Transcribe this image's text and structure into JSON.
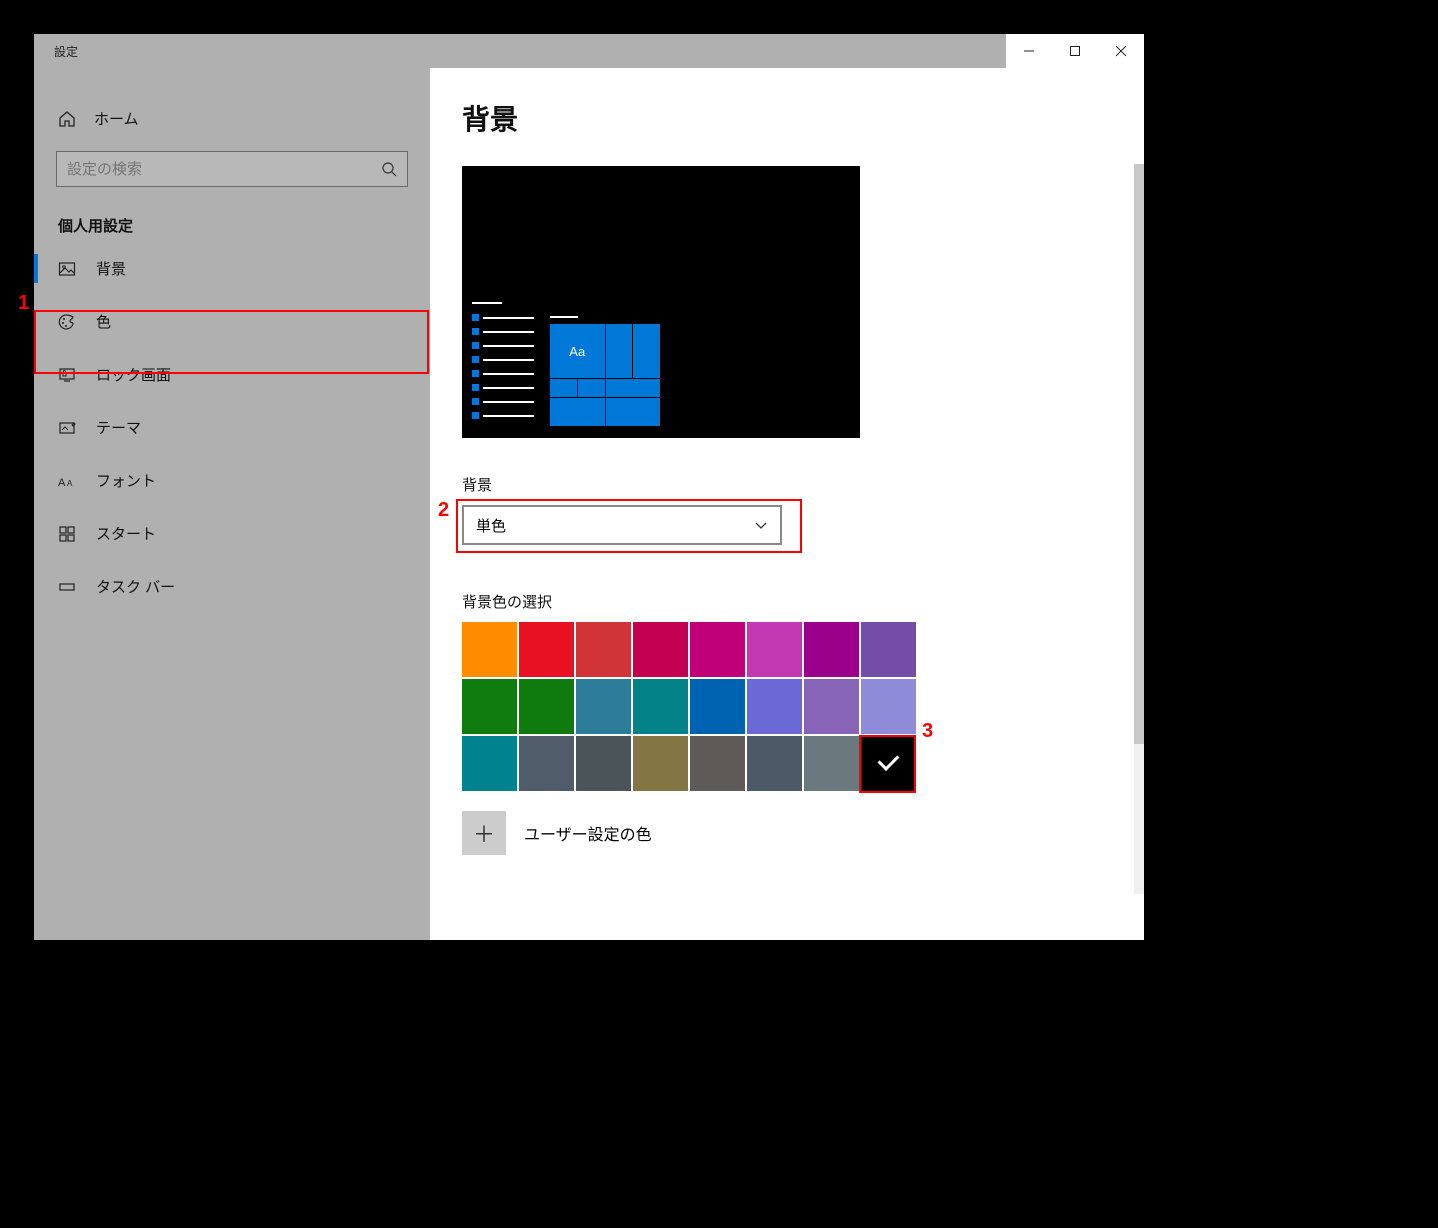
{
  "window": {
    "title": "設定"
  },
  "titlebar": {
    "minimize": "minimize",
    "maximize": "maximize",
    "close": "close"
  },
  "home": {
    "label": "ホーム"
  },
  "search": {
    "placeholder": "設定の検索"
  },
  "section": {
    "title": "個人用設定"
  },
  "nav": {
    "items": [
      {
        "label": "背景",
        "icon": "picture-icon",
        "active": true
      },
      {
        "label": "色",
        "icon": "palette-icon",
        "active": false
      },
      {
        "label": "ロック画面",
        "icon": "lockscreen-icon",
        "active": false
      },
      {
        "label": "テーマ",
        "icon": "theme-icon",
        "active": false
      },
      {
        "label": "フォント",
        "icon": "font-icon",
        "active": false
      },
      {
        "label": "スタート",
        "icon": "start-icon",
        "active": false
      },
      {
        "label": "タスク バー",
        "icon": "taskbar-icon",
        "active": false
      }
    ]
  },
  "page": {
    "title": "背景"
  },
  "preview": {
    "sample_text": "Aa"
  },
  "background_select": {
    "label": "背景",
    "value": "単色"
  },
  "color_section": {
    "label": "背景色の選択"
  },
  "colors": [
    "#ff8c00",
    "#e81123",
    "#d13438",
    "#c30052",
    "#bf0077",
    "#c239b3",
    "#9a0089",
    "#744da9",
    "#107c10",
    "#0f7b0f",
    "#2d7d9a",
    "#038387",
    "#0063b1",
    "#6b69d6",
    "#8764b8",
    "#8e8cd8",
    "#00838f",
    "#515c6b",
    "#4a5459",
    "#847545",
    "#5d5a58",
    "#4c5a68",
    "#69797e",
    "#000000"
  ],
  "selected_color_index": 23,
  "custom_color": {
    "label": "ユーザー設定の色"
  },
  "annotations": {
    "a1": "1",
    "a2": "2",
    "a3": "3"
  }
}
